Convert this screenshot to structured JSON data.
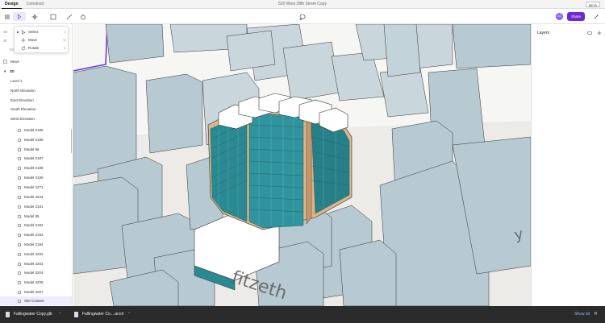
{
  "titlebar": {
    "tabs": [
      "Design",
      "Construct"
    ],
    "active_tab": "Design",
    "document_title": "520 West 28th Street Copy",
    "badge": "BETA"
  },
  "toolbar": {
    "tools": [
      "menu-icon",
      "select-tool-icon",
      "move-tool-icon",
      "shape-tool-icon",
      "pen-tool-icon",
      "bucket-tool-icon",
      "comment-icon"
    ],
    "avatar_initials": "AB",
    "share_label": "Share"
  },
  "menu": {
    "items": [
      {
        "label": "Select",
        "key": "V",
        "icon": "cursor-icon",
        "selected": true
      },
      {
        "label": "Move",
        "key": "W",
        "icon": "move-icon",
        "selected": false
      },
      {
        "label": "Rotate",
        "key": "E",
        "icon": "rotate-icon",
        "selected": false
      }
    ]
  },
  "sidebar": {
    "row0": "Se",
    "row0b": "St",
    "row1": "Issues Board",
    "views_label": "Views",
    "group_label": "3D",
    "views": [
      "Level 1",
      "North Elevation",
      "East Elevation",
      "South Elevation",
      "West Elevation"
    ],
    "models": [
      "Model 3185",
      "Model 3186",
      "Model 86",
      "Model 3187",
      "Model 3188",
      "Model 3190",
      "Model 3271",
      "Model 3234",
      "Model 3191",
      "Model 85",
      "Model 3192",
      "Model 3193",
      "Model 3194",
      "Model 3202",
      "Model 3203",
      "Model 3204",
      "Model 3205",
      "Model 3207"
    ],
    "context_label": "Site Context"
  },
  "right_panel": {
    "title": "Layers"
  },
  "downloads": {
    "files": [
      "Fallingwater Copy.glb",
      "Fallingwater Co....arcol"
    ],
    "show_all": "Show all",
    "close": "✕"
  },
  "colors": {
    "accent": "#6d28d9",
    "building_glass": "#2a8a93",
    "context_blocks": "#b5c8d0",
    "ground": "#e9e9e6"
  }
}
